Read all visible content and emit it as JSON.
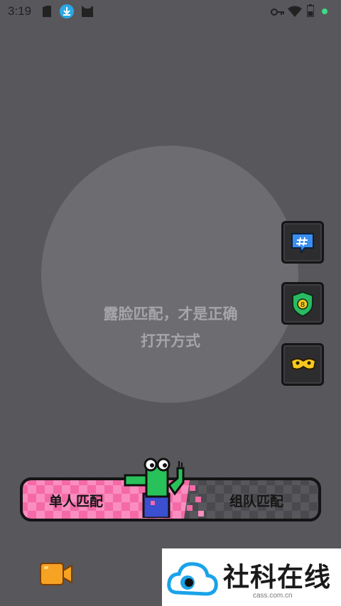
{
  "status_bar": {
    "time": "3:19",
    "icons": [
      "sim-card-icon",
      "download-icon",
      "cat-app-icon",
      "key-icon",
      "wifi-icon",
      "battery-icon",
      "dot-indicator-icon"
    ]
  },
  "center": {
    "hint_line1": "露脸匹配，才是正确",
    "hint_line2": "打开方式"
  },
  "side_buttons": [
    {
      "name": "chat-hash-button",
      "icon": "hash-chat-bubble-icon"
    },
    {
      "name": "shield-badge-button",
      "icon": "shield-icon"
    },
    {
      "name": "mask-filter-button",
      "icon": "eye-mask-icon"
    }
  ],
  "match": {
    "single_label": "单人匹配",
    "team_label": "组队匹配"
  },
  "bottom_bar": {
    "camera_icon": "camera-icon"
  },
  "watermark": {
    "title": "社科在线",
    "url": "cass.com.cn"
  },
  "colors": {
    "background": "#58575c",
    "circle": "#6d6c70",
    "pink": "#f46aa6",
    "dark_checker": "#47464a",
    "crocodile_green": "#29c25a",
    "camera_orange": "#f6a223"
  }
}
